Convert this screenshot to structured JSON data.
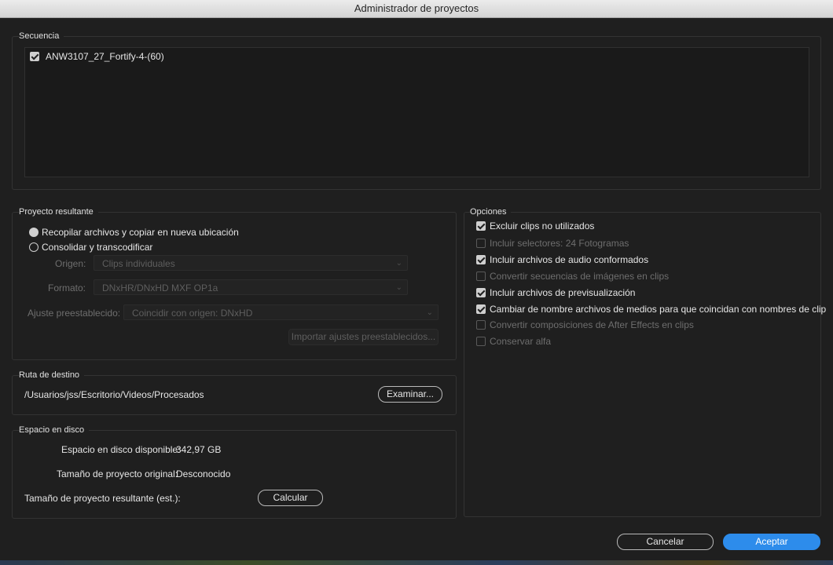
{
  "window": {
    "title": "Administrador de proyectos"
  },
  "sequence": {
    "legend": "Secuencia",
    "items": [
      {
        "label": "ANW3107_27_Fortify-4-(60)",
        "checked": true
      }
    ]
  },
  "project": {
    "legend": "Proyecto resultante",
    "radio_collect": "Recopilar archivos y copiar en nueva ubicación",
    "radio_consolidate": "Consolidar y transcodificar",
    "origin_label": "Origen:",
    "origin_value": "Clips individuales",
    "format_label": "Formato:",
    "format_value": "DNxHR/DNxHD MXF OP1a",
    "preset_label": "Ajuste preestablecido:",
    "preset_value": "Coincidir con origen: DNxHD",
    "import_button": "Importar ajustes preestablecidos..."
  },
  "destination": {
    "legend": "Ruta de destino",
    "path": "/Usuarios/jss/Escritorio/Videos/Procesados",
    "browse_button": "Examinar..."
  },
  "disk": {
    "legend": "Espacio en disco",
    "available_label": "Espacio en disco disponible:",
    "available_value": "342,97 GB",
    "original_label": "Tamaño de proyecto original:",
    "original_value": "Desconocido",
    "result_label": "Tamaño de proyecto resultante (est.):",
    "calc_button": "Calcular"
  },
  "options": {
    "legend": "Opciones",
    "items": [
      {
        "label": "Excluir clips no utilizados",
        "checked": true,
        "enabled": true
      },
      {
        "label": "Incluir selectores:  24 Fotogramas",
        "checked": false,
        "enabled": false
      },
      {
        "label": "Incluir archivos de audio conformados",
        "checked": true,
        "enabled": true
      },
      {
        "label": "Convertir secuencias de imágenes en clips",
        "checked": false,
        "enabled": false
      },
      {
        "label": "Incluir archivos de previsualización",
        "checked": true,
        "enabled": true
      },
      {
        "label": "Cambiar de nombre archivos de medios para que coincidan con nombres de clip",
        "checked": true,
        "enabled": true
      },
      {
        "label": "Convertir composiciones de After Effects en clips",
        "checked": false,
        "enabled": false
      },
      {
        "label": "Conservar alfa",
        "checked": false,
        "enabled": false
      }
    ]
  },
  "footer": {
    "cancel_button": "Cancelar",
    "accept_button": "Aceptar"
  }
}
